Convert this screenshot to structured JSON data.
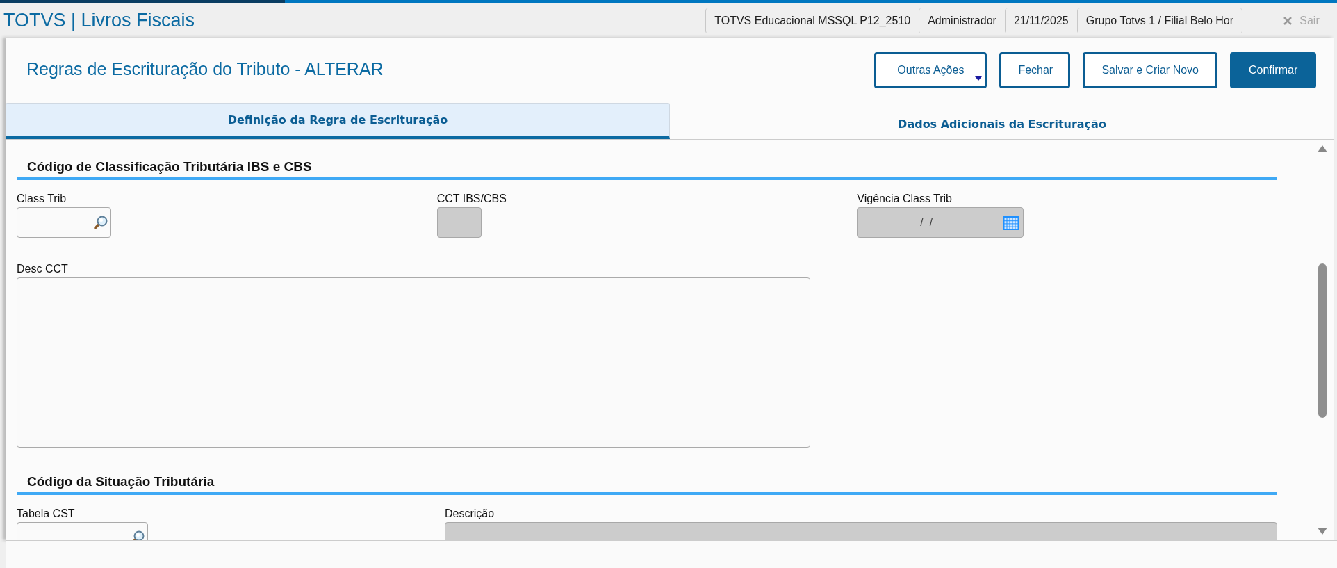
{
  "app_title": "TOTVS | Livros Fiscais",
  "status_items": [
    "TOTVS Educacional MSSQL P12_2510",
    "Administrador",
    "21/11/2025",
    "Grupo Totvs 1 / Filial Belo Hor"
  ],
  "exit_button": {
    "label": "Sair"
  },
  "page_title": "Regras de Escrituração do Tributo - ALTERAR",
  "actions": [
    {
      "label": "Outras Ações",
      "kind": "menu"
    },
    {
      "label": "Fechar",
      "kind": "outline"
    },
    {
      "label": "Salvar e Criar Novo",
      "kind": "outline"
    },
    {
      "label": "Confirmar",
      "kind": "primary"
    }
  ],
  "tabs": [
    {
      "label": "Definição da Regra de Escrituração",
      "selected": true
    },
    {
      "label": "Dados Adicionais da Escrituração",
      "selected": false
    }
  ],
  "sections": [
    {
      "title": "Código de Classificação Tributária IBS e CBS",
      "rows": [
        [
          {
            "label": "Class Trib",
            "kind": "lookup",
            "disabled": false
          },
          {
            "label": "CCT IBS/CBS",
            "kind": "text",
            "disabled": true
          },
          {
            "label": "Vigência Class Trib",
            "kind": "date",
            "disabled": true,
            "value": "/  /"
          }
        ],
        [
          {
            "label": "Desc CCT",
            "kind": "memo",
            "disabled": false
          }
        ]
      ]
    },
    {
      "title": "Código da Situação Tributária",
      "rows": [
        [
          {
            "label": "Tabela CST",
            "kind": "lookup",
            "disabled": false
          },
          {
            "label": "Descrição",
            "kind": "wide",
            "disabled": true
          }
        ]
      ]
    }
  ]
}
